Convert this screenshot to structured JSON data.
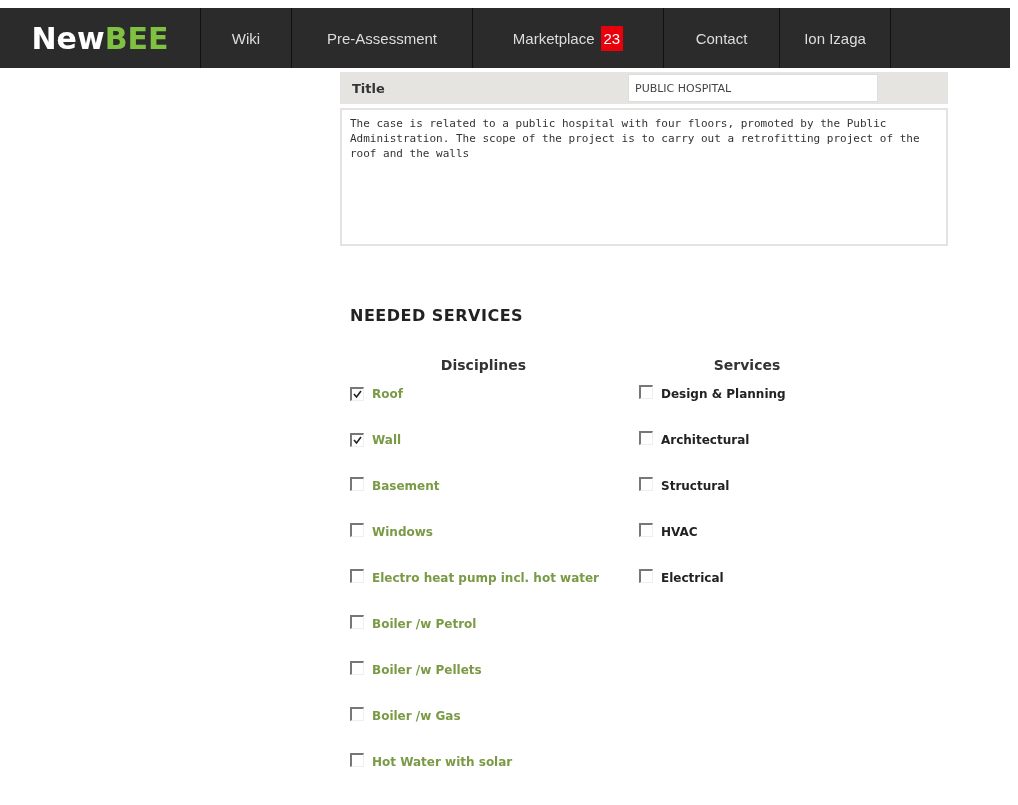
{
  "navbar": {
    "logo": {
      "text": "New",
      "accent": "BEE"
    },
    "items": [
      {
        "label": "Wiki",
        "selected": false
      },
      {
        "label": "Pre-Assessment",
        "selected": false
      },
      {
        "label": "Marketplace",
        "selected": false,
        "badge": "23"
      },
      {
        "label": "Contact",
        "selected": false
      },
      {
        "label": "Ion Izaga",
        "selected": false
      }
    ]
  },
  "form": {
    "title_label": "Title",
    "title_value": "PUBLIC HOSPITAL",
    "description": "The case is related to a public hospital with four floors, promoted by the Public Administration. The scope of the project is to carry out a retrofitting project of the roof and the walls"
  },
  "needed_services": {
    "heading": "NEEDED SERVICES",
    "disciplines": {
      "heading": "Disciplines",
      "items": [
        {
          "label": "Roof",
          "checked": true
        },
        {
          "label": "Wall",
          "checked": true
        },
        {
          "label": "Basement",
          "checked": false
        },
        {
          "label": "Windows",
          "checked": false
        },
        {
          "label": "Electro heat pump incl. hot water",
          "checked": false
        },
        {
          "label": "Boiler /w Petrol",
          "checked": false
        },
        {
          "label": "Boiler /w Pellets",
          "checked": false
        },
        {
          "label": "Boiler /w Gas",
          "checked": false
        },
        {
          "label": "Hot Water with solar",
          "checked": false
        }
      ]
    },
    "services": {
      "heading": "Services",
      "items": [
        {
          "label": "Design & Planning",
          "checked": false
        },
        {
          "label": "Architectural",
          "checked": false
        },
        {
          "label": "Structural",
          "checked": false
        },
        {
          "label": "HVAC",
          "checked": false
        },
        {
          "label": "Electrical",
          "checked": false
        }
      ]
    }
  }
}
